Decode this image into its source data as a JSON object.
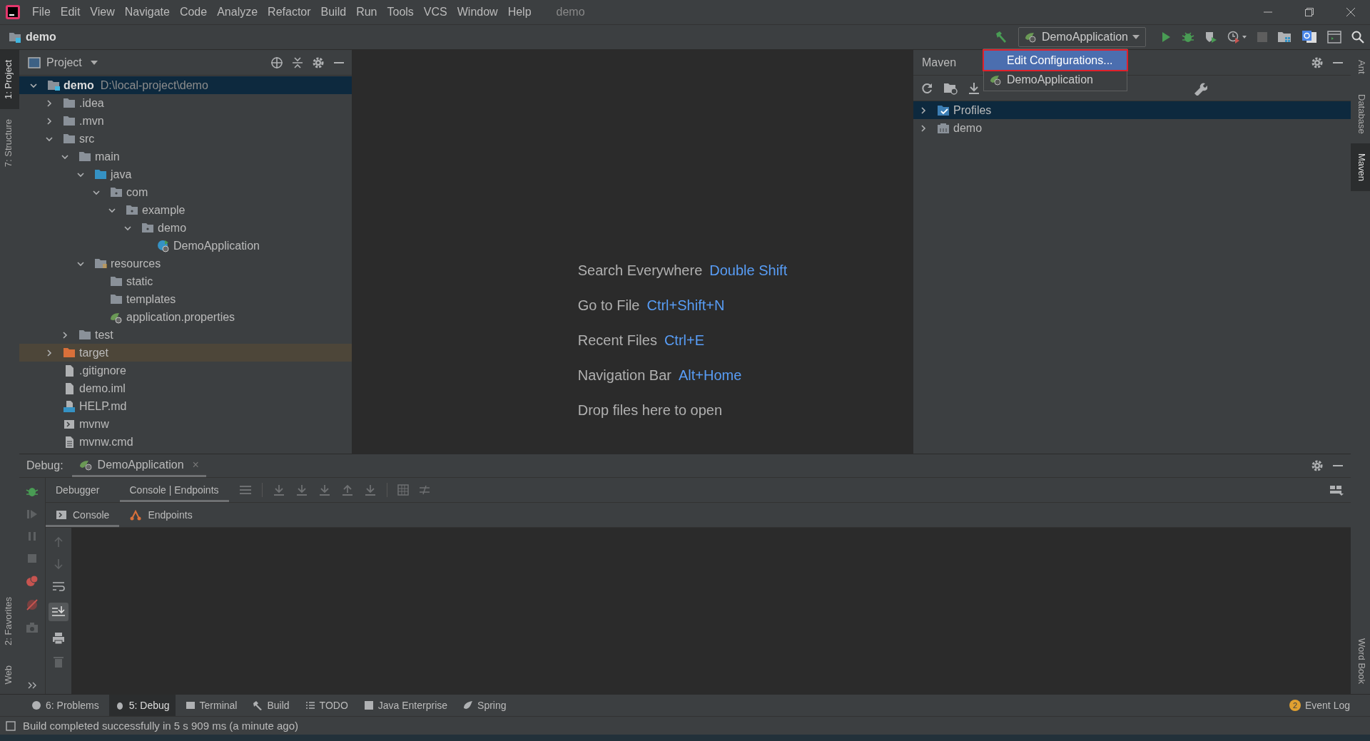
{
  "menu_bar": {
    "items": [
      "File",
      "Edit",
      "View",
      "Navigate",
      "Code",
      "Analyze",
      "Refactor",
      "Build",
      "Run",
      "Tools",
      "VCS",
      "Window",
      "Help"
    ],
    "title": "demo"
  },
  "nav_bar": {
    "breadcrumb": "demo",
    "run_config": "DemoApplication"
  },
  "run_config_popup": [
    {
      "label": "Edit Configurations...",
      "kind": "action",
      "selected": true
    },
    {
      "label": "DemoApplication",
      "kind": "config",
      "selected": false
    }
  ],
  "left_strip": {
    "top": [
      {
        "label": "1: Project",
        "selected": true
      },
      {
        "label": "7: Structure",
        "selected": false
      }
    ],
    "bottom": [
      {
        "label": "2: Favorites",
        "selected": false
      },
      {
        "label": "Web",
        "selected": false
      }
    ]
  },
  "right_strip": {
    "top": [
      {
        "label": "Ant",
        "selected": false
      },
      {
        "label": "Database",
        "selected": false
      },
      {
        "label": "Maven",
        "selected": true
      }
    ],
    "bottom": [
      {
        "label": "Word Book",
        "selected": false
      }
    ]
  },
  "project_panel": {
    "title": "Project"
  },
  "project_tree": [
    {
      "name": "demo",
      "path": "D:\\local-project\\demo",
      "kind": "module",
      "expanded": true,
      "selected": true,
      "highlighted": false,
      "children": [
        {
          "name": ".idea",
          "kind": "folder",
          "expanded": false,
          "selected": false,
          "highlighted": false
        },
        {
          "name": ".mvn",
          "kind": "folder",
          "expanded": false,
          "selected": false,
          "highlighted": false
        },
        {
          "name": "src",
          "kind": "folder",
          "expanded": true,
          "selected": false,
          "highlighted": false,
          "children": [
            {
              "name": "main",
              "kind": "folder",
              "expanded": true,
              "selected": false,
              "highlighted": false,
              "children": [
                {
                  "name": "java",
                  "kind": "source",
                  "expanded": true,
                  "selected": false,
                  "highlighted": false,
                  "children": [
                    {
                      "name": "com",
                      "kind": "package",
                      "expanded": true,
                      "selected": false,
                      "highlighted": false,
                      "children": [
                        {
                          "name": "example",
                          "kind": "package",
                          "expanded": true,
                          "selected": false,
                          "highlighted": false,
                          "children": [
                            {
                              "name": "demo",
                              "kind": "package",
                              "expanded": true,
                              "selected": false,
                              "highlighted": false,
                              "children": [
                                {
                                  "name": "DemoApplication",
                                  "kind": "spring-class",
                                  "selected": false,
                                  "highlighted": false
                                }
                              ]
                            }
                          ]
                        }
                      ]
                    }
                  ]
                },
                {
                  "name": "resources",
                  "kind": "resources",
                  "expanded": true,
                  "selected": false,
                  "highlighted": false,
                  "children": [
                    {
                      "name": "static",
                      "kind": "folder",
                      "selected": false,
                      "highlighted": false
                    },
                    {
                      "name": "templates",
                      "kind": "folder",
                      "selected": false,
                      "highlighted": false
                    },
                    {
                      "name": "application.properties",
                      "kind": "properties",
                      "selected": false,
                      "highlighted": false
                    }
                  ]
                }
              ]
            },
            {
              "name": "test",
              "kind": "folder",
              "expanded": false,
              "selected": false,
              "highlighted": false
            }
          ]
        },
        {
          "name": "target",
          "kind": "excluded",
          "expanded": false,
          "selected": false,
          "highlighted": true
        },
        {
          "name": ".gitignore",
          "kind": "file",
          "selected": false,
          "highlighted": false
        },
        {
          "name": "demo.iml",
          "kind": "file",
          "selected": false,
          "highlighted": false
        },
        {
          "name": "HELP.md",
          "kind": "markdown",
          "selected": false,
          "highlighted": false
        },
        {
          "name": "mvnw",
          "kind": "script",
          "selected": false,
          "highlighted": false
        },
        {
          "name": "mvnw.cmd",
          "kind": "text",
          "selected": false,
          "highlighted": false
        }
      ]
    }
  ],
  "editor_hints": [
    {
      "label": "Search Everywhere",
      "shortcut": "Double Shift"
    },
    {
      "label": "Go to File",
      "shortcut": "Ctrl+Shift+N"
    },
    {
      "label": "Recent Files",
      "shortcut": "Ctrl+E"
    },
    {
      "label": "Navigation Bar",
      "shortcut": "Alt+Home"
    },
    {
      "label": "Drop files here to open"
    }
  ],
  "maven_panel": {
    "title": "Maven",
    "tree": [
      {
        "name": "Profiles",
        "kind": "profiles",
        "expanded": false,
        "selected": true
      },
      {
        "name": "demo",
        "kind": "module",
        "expanded": false,
        "selected": false
      }
    ]
  },
  "debug_panel": {
    "title": "Debug:",
    "session": "DemoApplication",
    "close": "×",
    "tabs": [
      {
        "label": "Debugger",
        "selected": false
      },
      {
        "label": "Console | Endpoints",
        "selected": true
      }
    ],
    "subtabs": [
      {
        "label": "Console",
        "kind": "console",
        "selected": true
      },
      {
        "label": "Endpoints",
        "kind": "endpoints",
        "selected": false
      }
    ]
  },
  "tool_window_bar": [
    {
      "label": "6: Problems",
      "kind": "problems",
      "selected": false
    },
    {
      "label": "5: Debug",
      "kind": "debug",
      "selected": true
    },
    {
      "label": "Terminal",
      "kind": "terminal",
      "selected": false
    },
    {
      "label": "Build",
      "kind": "build",
      "selected": false
    },
    {
      "label": "TODO",
      "kind": "todo",
      "selected": false
    },
    {
      "label": "Java Enterprise",
      "kind": "enterprise",
      "selected": false
    },
    {
      "label": "Spring",
      "kind": "spring",
      "selected": false
    }
  ],
  "event_log": {
    "label": "Event Log",
    "count": "2"
  },
  "status_bar": "Build completed successfully in 5 s 909 ms (a minute ago)"
}
